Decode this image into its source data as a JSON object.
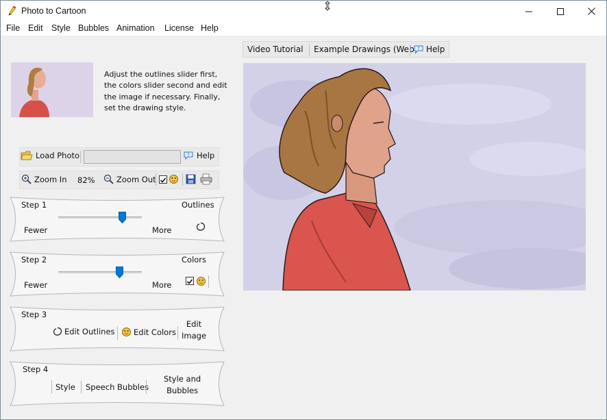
{
  "window": {
    "title": "Photo to Cartoon"
  },
  "menu": [
    "File",
    "Edit",
    "Style",
    "Bubbles",
    "Animation",
    "License",
    "Help"
  ],
  "instructions": {
    "line1": "Adjust the outlines slider first,",
    "line2": "the colors slider second and edit",
    "line3": "the image if necessary. Finally,",
    "line4": "set the drawing style."
  },
  "links": {
    "video": "Video Tutorial",
    "examples": "Example Drawings (Web)",
    "help": "Help"
  },
  "toolbar": {
    "load_photo": "Load Photo",
    "path_value": "",
    "help": "Help",
    "zoom_in": "Zoom In",
    "zoom_level": "82%",
    "zoom_out": "Zoom Out",
    "auto_checked": true
  },
  "step1": {
    "title": "Step 1",
    "heading": "Outlines",
    "min_label": "Fewer",
    "max_label": "More",
    "value": 0.77
  },
  "step2": {
    "title": "Step 2",
    "heading": "Colors",
    "min_label": "Fewer",
    "max_label": "More",
    "value": 0.73,
    "auto_checked": true
  },
  "step3": {
    "title": "Step 3",
    "edit_outlines": "Edit Outlines",
    "edit_colors": "Edit Colors",
    "edit_image_1": "Edit",
    "edit_image_2": "Image"
  },
  "step4": {
    "title": "Step 4",
    "style": "Style",
    "speech_bubbles": "Speech Bubbles",
    "sb_1": "Style and",
    "sb_2": "Bubbles"
  },
  "colors": {
    "accent": "#0078d7",
    "canvas_bg": "#d4d2e8",
    "shirt": "#d9554e",
    "hair": "#a87642",
    "skin": "#d9987e"
  }
}
